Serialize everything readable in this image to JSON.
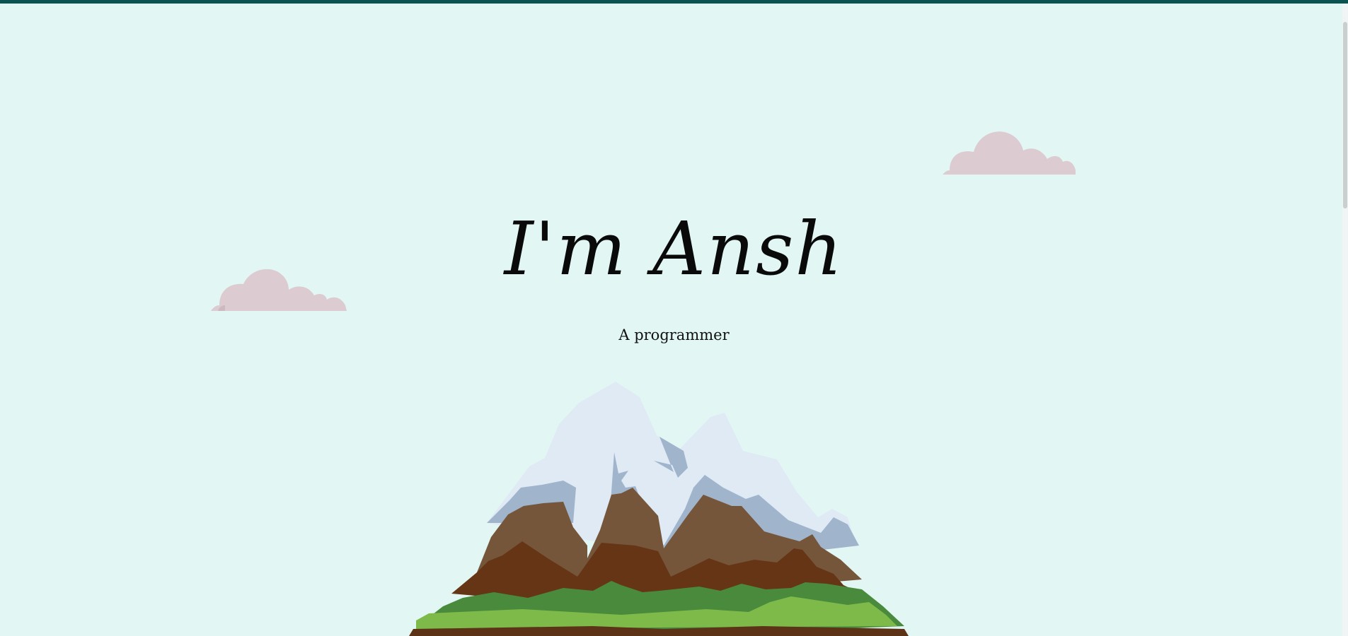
{
  "hero": {
    "title": "I'm Ansh",
    "subtitle": "A programmer"
  },
  "colors": {
    "background": "#e2f7f4",
    "top_bar": "#0b5351",
    "cloud": "#dccbd1",
    "snow_light": "#dfeaf5",
    "snow_shadow": "#a0b4cc",
    "rock_light": "#75563a",
    "rock_dark": "#653515",
    "grass_dark": "#4a8a3c",
    "grass_light": "#7dba4a",
    "soil": "#5c3317"
  },
  "icons": [
    "cloud-icon",
    "mountain-illustration"
  ]
}
